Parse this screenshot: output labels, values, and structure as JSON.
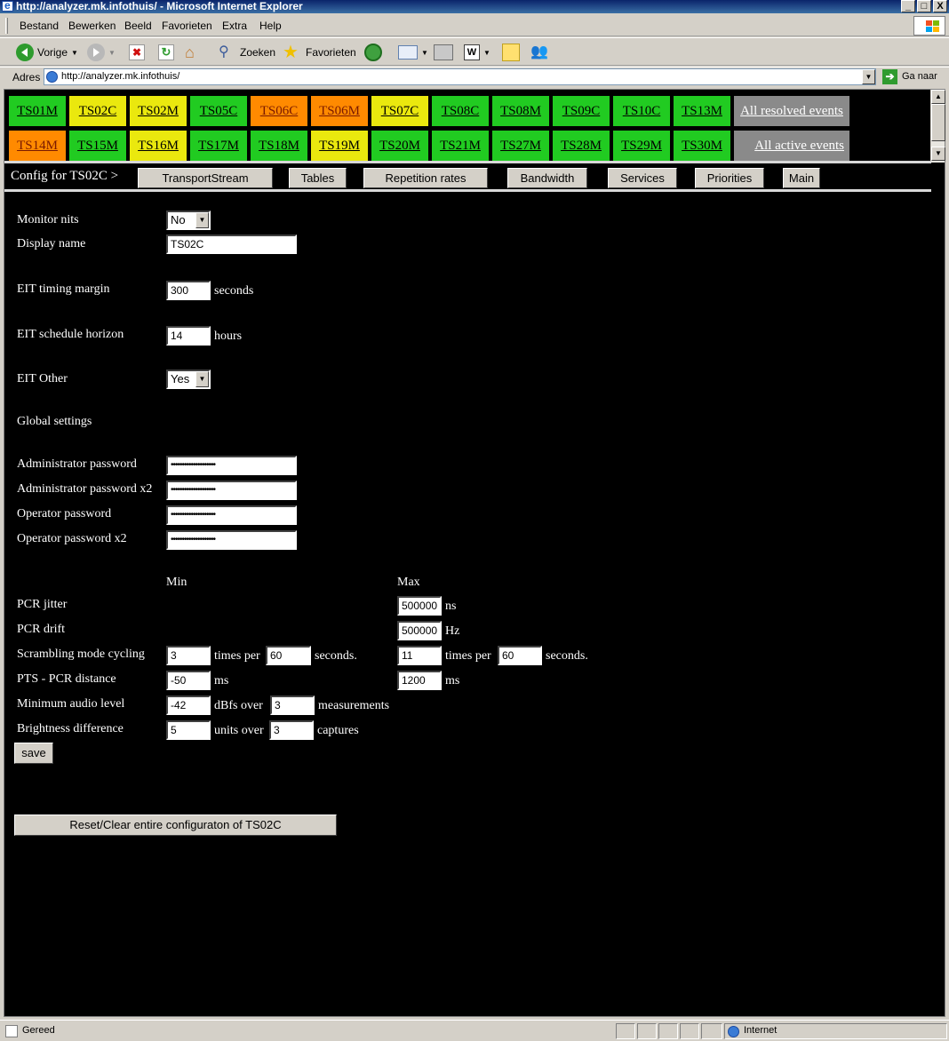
{
  "window": {
    "title": "http://analyzer.mk.infothuis/ - Microsoft Internet Explorer",
    "min": "_",
    "max": "□",
    "close": "X"
  },
  "menu": [
    "Bestand",
    "Bewerken",
    "Beeld",
    "Favorieten",
    "Extra",
    "Help"
  ],
  "toolbar": {
    "back": "Vorige",
    "search": "Zoeken",
    "favorites": "Favorieten"
  },
  "address": {
    "label": "Adres",
    "url": "http://analyzer.mk.infothuis/",
    "go": "Ga naar"
  },
  "tiles_row1": [
    {
      "label": "TS01M",
      "status": "green"
    },
    {
      "label": "TS02C",
      "status": "yellow"
    },
    {
      "label": "TS02M",
      "status": "yellow"
    },
    {
      "label": "TS05C",
      "status": "green"
    },
    {
      "label": "TS06C",
      "status": "orange"
    },
    {
      "label": "TS06M",
      "status": "orange"
    },
    {
      "label": "TS07C",
      "status": "yellow"
    },
    {
      "label": "TS08C",
      "status": "green"
    },
    {
      "label": "TS08M",
      "status": "green"
    },
    {
      "label": "TS09C",
      "status": "green"
    },
    {
      "label": "TS10C",
      "status": "green"
    },
    {
      "label": "TS13M",
      "status": "green"
    }
  ],
  "tiles_row2": [
    {
      "label": "TS14M",
      "status": "orange"
    },
    {
      "label": "TS15M",
      "status": "green"
    },
    {
      "label": "TS16M",
      "status": "yellow"
    },
    {
      "label": "TS17M",
      "status": "green"
    },
    {
      "label": "TS18M",
      "status": "green"
    },
    {
      "label": "TS19M",
      "status": "yellow"
    },
    {
      "label": "TS20M",
      "status": "green"
    },
    {
      "label": "TS21M",
      "status": "green"
    },
    {
      "label": "TS27M",
      "status": "green"
    },
    {
      "label": "TS28M",
      "status": "green"
    },
    {
      "label": "TS29M",
      "status": "green"
    },
    {
      "label": "TS30M",
      "status": "green"
    }
  ],
  "events": {
    "resolved": "All resolved events",
    "active": "All active events"
  },
  "config": {
    "label": "Config for TS02C >",
    "nav": [
      "TransportStream",
      "Tables",
      "Repetition rates",
      "Bandwidth",
      "Services",
      "Priorities",
      "Main"
    ]
  },
  "form": {
    "monitor_nits": {
      "label": "Monitor nits",
      "value": "No"
    },
    "display_name": {
      "label": "Display name",
      "value": "TS02C"
    },
    "eit_timing": {
      "label": "EIT timing margin",
      "value": "300",
      "unit": "seconds"
    },
    "eit_schedule": {
      "label": "EIT schedule horizon",
      "value": "14",
      "unit": "hours"
    },
    "eit_other": {
      "label": "EIT Other",
      "value": "Yes"
    },
    "global": "Global settings",
    "admin_pw": {
      "label": "Administrator password",
      "value": "••••••••••••••••••••"
    },
    "admin_pw2": {
      "label": "Administrator password x2",
      "value": "••••••••••••••••••••"
    },
    "oper_pw": {
      "label": "Operator password",
      "value": "••••••••••••••••••••"
    },
    "oper_pw2": {
      "label": "Operator password x2",
      "value": "••••••••••••••••••••"
    },
    "min_header": "Min",
    "max_header": "Max",
    "pcr_jitter": {
      "label": "PCR jitter",
      "max": "500000",
      "unit": "ns"
    },
    "pcr_drift": {
      "label": "PCR drift",
      "max": "500000",
      "unit": "Hz"
    },
    "scrambling": {
      "label": "Scrambling mode cycling",
      "min_times": "3",
      "min_per": "60",
      "max_times": "11",
      "max_per": "60",
      "times_per": "times per",
      "seconds_dot": "seconds."
    },
    "pts_pcr": {
      "label": "PTS - PCR distance",
      "min": "-50",
      "max": "1200",
      "unit": "ms"
    },
    "audio": {
      "label": "Minimum audio level",
      "min": "-42",
      "over_label": "dBfs over",
      "over": "3",
      "unit": "measurements"
    },
    "brightness": {
      "label": "Brightness difference",
      "min": "5",
      "over_label": "units over",
      "over": "3",
      "unit": "captures"
    },
    "save": "save",
    "reset": "Reset/Clear entire configuraton of TS02C"
  },
  "status": {
    "left": "Gereed",
    "zone": "Internet"
  }
}
